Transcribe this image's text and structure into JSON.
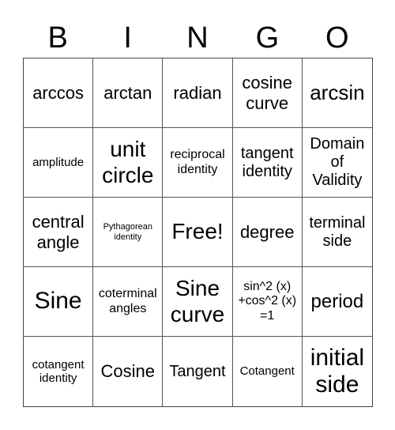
{
  "header": {
    "letters": [
      "B",
      "I",
      "N",
      "G",
      "O"
    ]
  },
  "cells": [
    "arccos",
    "arctan",
    "radian",
    "cosine curve",
    "arcsin",
    "amplitude",
    "unit circle",
    "reciprocal identity",
    "tangent identity",
    "Domain of Validity",
    "central angle",
    "Pythagorean identity",
    "Free!",
    "degree",
    "terminal side",
    "Sine",
    "coterminal angles",
    "Sine curve",
    "sin^2 (x) +cos^2 (x) =1",
    "period",
    "cotangent identity",
    "Cosine",
    "Tangent",
    "Cotangent",
    "initial side"
  ]
}
